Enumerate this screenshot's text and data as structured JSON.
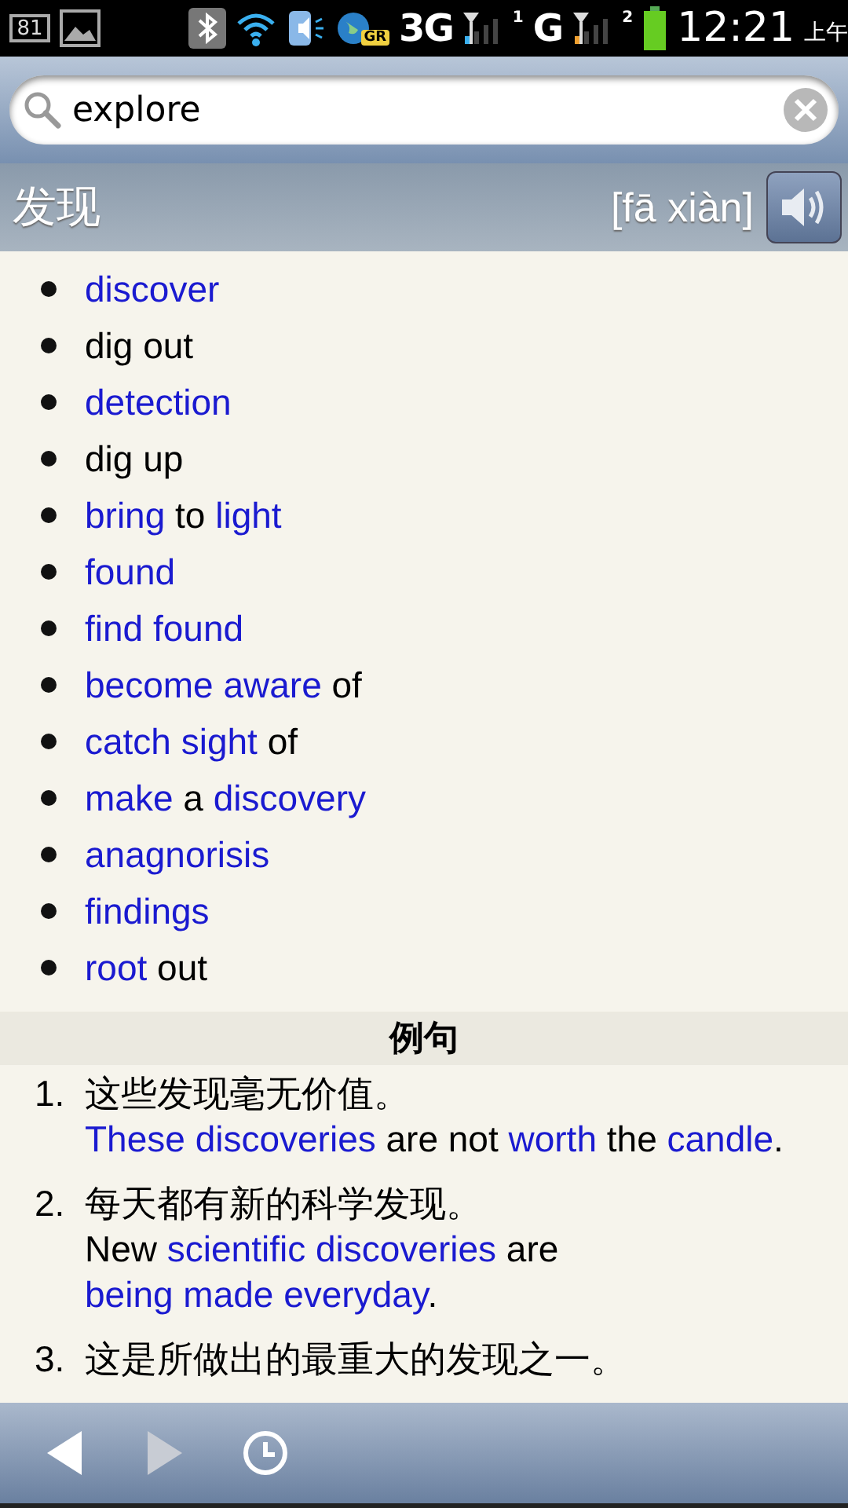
{
  "status_bar": {
    "battery_text": "81",
    "network_3g": "3G",
    "sim1": "1",
    "network_g": "G",
    "sim2": "2",
    "roaming_badge": "GR",
    "time": "12:21",
    "ampm": "上午"
  },
  "search": {
    "value": "explore"
  },
  "entry": {
    "headword": "发现",
    "pinyin": "[fā xiàn]"
  },
  "definitions": [
    {
      "parts": [
        {
          "text": "discover",
          "link": true
        }
      ]
    },
    {
      "parts": [
        {
          "text": "dig out",
          "link": false
        }
      ]
    },
    {
      "parts": [
        {
          "text": "detection",
          "link": true
        }
      ]
    },
    {
      "parts": [
        {
          "text": "dig up",
          "link": false
        }
      ]
    },
    {
      "parts": [
        {
          "text": "bring",
          "link": true
        },
        {
          "text": " to ",
          "link": false
        },
        {
          "text": "light",
          "link": true
        }
      ]
    },
    {
      "parts": [
        {
          "text": "found",
          "link": true
        }
      ]
    },
    {
      "parts": [
        {
          "text": "find found",
          "link": true
        }
      ]
    },
    {
      "parts": [
        {
          "text": "become aware",
          "link": true
        },
        {
          "text": " of",
          "link": false
        }
      ]
    },
    {
      "parts": [
        {
          "text": "catch sight",
          "link": true
        },
        {
          "text": " of",
          "link": false
        }
      ]
    },
    {
      "parts": [
        {
          "text": "make",
          "link": true
        },
        {
          "text": " a ",
          "link": false
        },
        {
          "text": "discovery",
          "link": true
        }
      ]
    },
    {
      "parts": [
        {
          "text": "anagnorisis",
          "link": true
        }
      ]
    },
    {
      "parts": [
        {
          "text": "findings",
          "link": true
        }
      ]
    },
    {
      "parts": [
        {
          "text": "root",
          "link": true
        },
        {
          "text": " out",
          "link": false
        }
      ]
    }
  ],
  "examples_heading": "例句",
  "examples": [
    {
      "number": "1.",
      "chinese": "这些发现毫无价值。",
      "english": [
        {
          "text": "These discoveries",
          "link": true
        },
        {
          "text": " are not ",
          "link": false
        },
        {
          "text": "worth",
          "link": true
        },
        {
          "text": " the ",
          "link": false
        },
        {
          "text": "candle",
          "link": true
        },
        {
          "text": ".",
          "link": false
        }
      ]
    },
    {
      "number": "2.",
      "chinese": "每天都有新的科学发现。",
      "english": [
        {
          "text": "New ",
          "link": false
        },
        {
          "text": "scientific discoveries",
          "link": true
        },
        {
          "text": " are ",
          "link": false
        },
        {
          "text": "being made",
          "link": true
        },
        {
          "text": " everyday",
          "link": true
        },
        {
          "text": ".",
          "link": false
        }
      ]
    },
    {
      "number": "3.",
      "chinese": "这是所做出的最重大的发现之一。"
    }
  ]
}
